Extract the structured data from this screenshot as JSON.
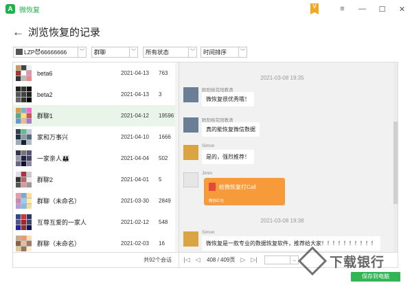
{
  "window": {
    "app_logo": "A",
    "app_title": "微恢复",
    "vip_label": "V",
    "controls": {
      "menu": "≡",
      "minimize": "—",
      "maximize": "☐",
      "close": "✕"
    }
  },
  "header": {
    "back_icon": "←",
    "title": "浏览恢复的记录"
  },
  "filters": {
    "account": "LZP😈66666666",
    "type": "群聊",
    "status": "所有状态",
    "sort": "时间排序"
  },
  "conversations": [
    {
      "name": "beta6",
      "date": "2021-04-13",
      "count": "763",
      "selected": false
    },
    {
      "name": "beta2",
      "date": "2021-04-13",
      "count": "3",
      "selected": false
    },
    {
      "name": "群聊1",
      "date": "2021-04-12",
      "count": "19596",
      "selected": true
    },
    {
      "name": "家和万事兴",
      "date": "2021-04-10",
      "count": "1666",
      "selected": false
    },
    {
      "name": "一家亲人👪",
      "date": "2021-04-04",
      "count": "502",
      "selected": false
    },
    {
      "name": "群聊2",
      "date": "2021-04-01",
      "count": "5",
      "selected": false
    },
    {
      "name": "群聊（未命名）",
      "date": "2021-03-30",
      "count": "2849",
      "selected": false
    },
    {
      "name": "互尊互爱的一家人",
      "date": "2021-02-12",
      "count": "548",
      "selected": false
    },
    {
      "name": "群聊（未命名）",
      "date": "2021-02-03",
      "count": "16",
      "selected": false
    }
  ],
  "list_footer": "共92个会话",
  "chat": {
    "time1": "2021-03-08 19:35",
    "time2": "2021-03-08 19:38",
    "messages": [
      {
        "sender": "欧阳桂花阳教清",
        "text": "微恢复很优秀哦！"
      },
      {
        "sender": "欧阳桂花阳教清",
        "text": "真的能恢复微信数据"
      },
      {
        "sender": "Simon",
        "text": "是的，强烈推荐！"
      },
      {
        "sender": "Jimin",
        "text": ""
      },
      {
        "sender": "Simon",
        "text": "微恢复是一款专业的数据恢复软件，推荐给大家！！！！！！！！！！"
      }
    ],
    "redpacket": {
      "title": "给微恢复打Call",
      "footer": "微信红包"
    }
  },
  "pager": {
    "first": "|◁",
    "prev": "◁",
    "page_info": "408 / 409页",
    "next": "▷",
    "last": "▷|",
    "go": "→"
  },
  "save_button": "保存到电脑",
  "watermark": "下载银行"
}
